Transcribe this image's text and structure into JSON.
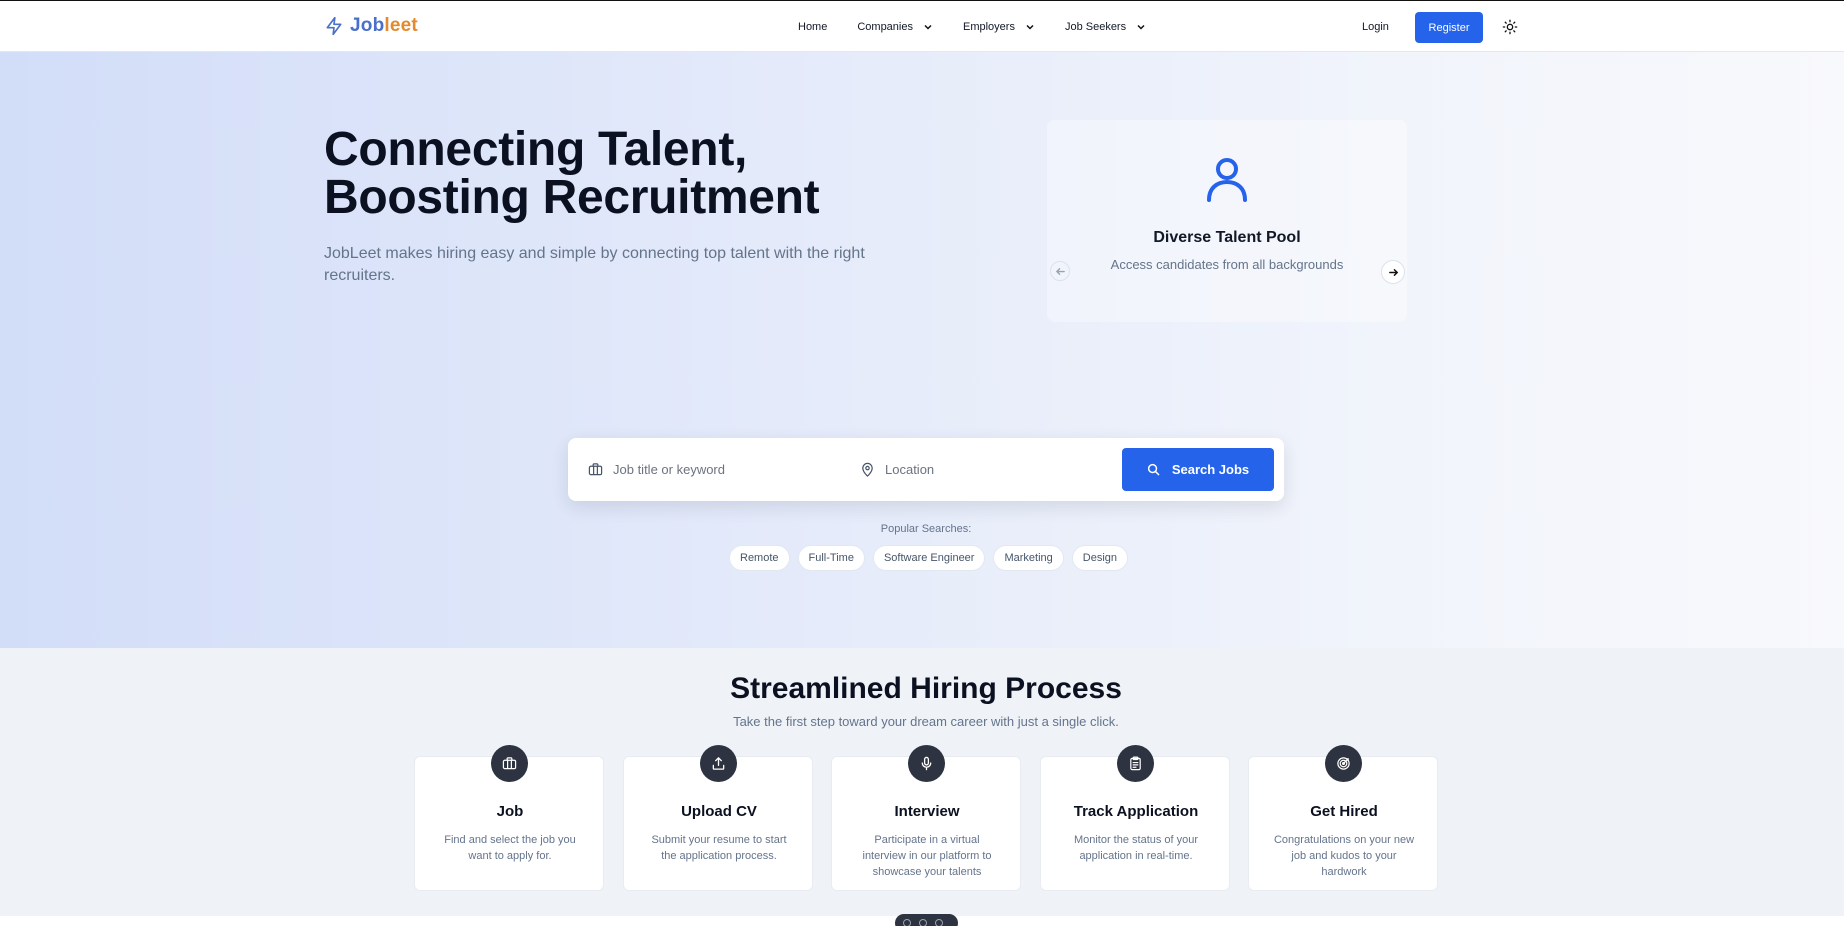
{
  "brand": {
    "part1": "Job",
    "part2": "leet"
  },
  "nav": {
    "home": "Home",
    "companies": "Companies",
    "employers": "Employers",
    "job_seekers": "Job Seekers",
    "login": "Login",
    "register": "Register"
  },
  "hero": {
    "title_line1": "Connecting Talent,",
    "title_line2": "Boosting Recruitment",
    "subtitle": "JobLeet makes hiring easy and simple by connecting top talent with the right recruiters."
  },
  "carousel": {
    "icon": "user-icon",
    "title": "Diverse Talent Pool",
    "description": "Access candidates from all backgrounds"
  },
  "search": {
    "job_placeholder": "Job title or keyword",
    "location_placeholder": "Location",
    "button": "Search Jobs"
  },
  "popular": {
    "label": "Popular Searches:",
    "tags": [
      "Remote",
      "Full-Time",
      "Software Engineer",
      "Marketing",
      "Design"
    ]
  },
  "process": {
    "title": "Streamlined Hiring Process",
    "subtitle": "Take the first step toward your dream career with just a single click.",
    "steps": [
      {
        "icon": "briefcase-icon",
        "title": "Job",
        "desc": "Find and select the job you want to apply for."
      },
      {
        "icon": "upload-icon",
        "title": "Upload CV",
        "desc": "Submit your resume to start the application process."
      },
      {
        "icon": "microphone-icon",
        "title": "Interview",
        "desc": "Participate in a virtual interview in our platform to showcase your talents"
      },
      {
        "icon": "clipboard-icon",
        "title": "Track Application",
        "desc": "Monitor the status of your application in real-time."
      },
      {
        "icon": "target-icon",
        "title": "Get Hired",
        "desc": "Congratulations on your new job and kudos to your hardwork"
      }
    ]
  },
  "colors": {
    "primary": "#2563eb",
    "brand_blue": "#4b70c9",
    "brand_orange": "#e38a2e",
    "icon_circle": "#2d3340"
  }
}
